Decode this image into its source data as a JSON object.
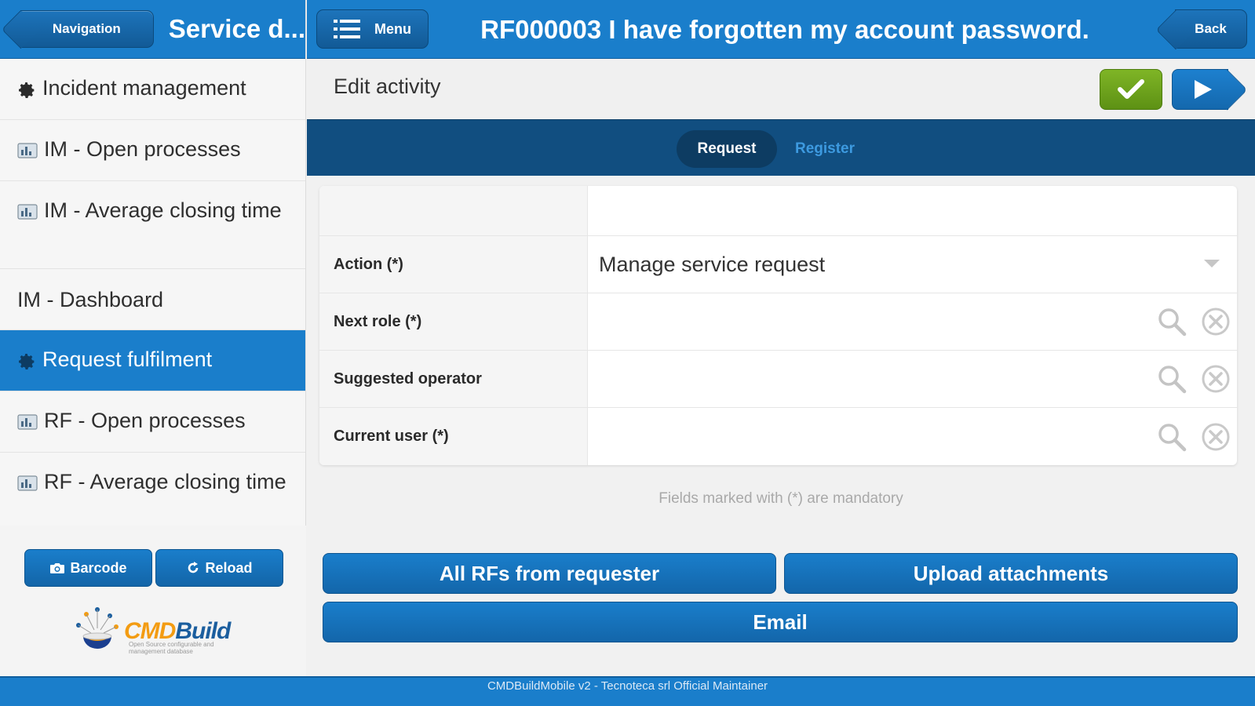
{
  "left_panel": {
    "nav_button_label": "Navigation",
    "title": "Service d...",
    "nav_items": [
      {
        "label": "Incident management",
        "icon": "gear-icon",
        "selected": false
      },
      {
        "label": "IM - Open processes",
        "icon": "chart-icon",
        "selected": false
      },
      {
        "label": "IM - Average closing time",
        "icon": "chart-icon",
        "selected": false
      },
      {
        "label": "IM - Dashboard",
        "icon": "",
        "selected": false
      },
      {
        "label": "Request fulfilment",
        "icon": "gear-icon",
        "selected": true
      },
      {
        "label": "RF - Open processes",
        "icon": "chart-icon",
        "selected": false
      },
      {
        "label": "RF - Average closing time",
        "icon": "chart-icon",
        "selected": false
      }
    ],
    "barcode_label": "Barcode",
    "reload_label": "Reload",
    "logo_text_a": "CMD",
    "logo_text_b": "Build",
    "logo_sub": "Open Source configurable and management database"
  },
  "top_bar": {
    "menu_label": "Menu",
    "title": "RF000003 I have forgotten my account password.",
    "back_label": "Back"
  },
  "sub_bar": {
    "title": "Edit activity"
  },
  "tabs": [
    {
      "label": "Request",
      "active": true
    },
    {
      "label": "Register",
      "active": false
    }
  ],
  "form": {
    "rows": [
      {
        "label": "",
        "value": ""
      },
      {
        "label": "Action (*)",
        "value": "Manage service request"
      },
      {
        "label": "Next role (*)",
        "value": ""
      },
      {
        "label": "Suggested operator",
        "value": ""
      },
      {
        "label": "Current user (*)",
        "value": ""
      }
    ],
    "mandatory_note": "Fields marked with (*) are mandatory"
  },
  "actions": {
    "all_rfs": "All RFs from requester",
    "upload": "Upload attachments",
    "email": "Email"
  },
  "footer": {
    "text": "CMDBuildMobile v2 - Tecnoteca srl Official Maintainer"
  },
  "colors": {
    "primary": "#1a7ecb",
    "dark_primary": "#114e80",
    "save_green": "#6ea51d"
  }
}
